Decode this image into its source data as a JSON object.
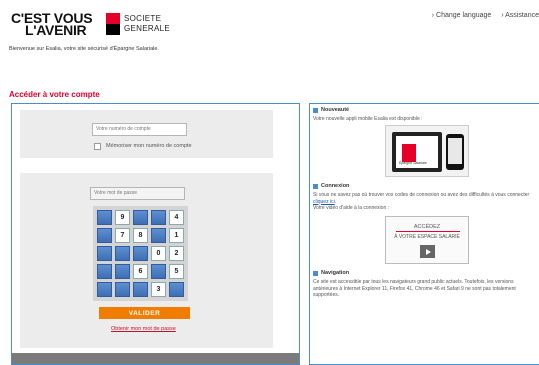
{
  "header": {
    "brand_line1": "C'EST VOUS",
    "brand_line2": "L'AVENIR",
    "bank_line1": "SOCIETE",
    "bank_line2": "GENERALE",
    "change_language": "› Change language",
    "assistance": "› Assistance",
    "welcome": "Bienvenue sur Esalia, votre site sécurisé d'Épargne Salariale."
  },
  "login": {
    "title": "Accéder à votre compte",
    "account_placeholder": "Votre numéro de compte",
    "remember_label": "Mémoriser mon numéro de compte",
    "password_placeholder": "Votre mot de passe",
    "keypad": [
      "",
      "9",
      "",
      "",
      "4",
      "",
      "7",
      "8",
      "",
      "1",
      "",
      "",
      "",
      "0",
      "2",
      "",
      "",
      "6",
      "",
      "5",
      "",
      "",
      "",
      "3",
      ""
    ],
    "validate_button": "VALIDER",
    "forgot_link": "Obtenir mon mot de passe"
  },
  "news": {
    "title": "Nouveauté",
    "text": "Votre nouvelle appli mobile Esalia est disponible :",
    "tablet_caption": "Épargne Salariale"
  },
  "connexion": {
    "title": "Connexion",
    "text_before_link": "Si vous ne savez pas où trouver vos codes de connexion ou avez des difficultés à vous connecter ",
    "link": "cliquez ici",
    "text_after_link": ".",
    "video_intro": "Votre vidéo d'aide à la connexion :",
    "video_title": "ACCÉDEZ",
    "video_subtitle": "À VOTRE ESPACE SALARIÉ"
  },
  "navigation": {
    "title": "Navigation",
    "text": "Ce site est accessible par tous les navigateurs grand public actuels. Toutefois, les versions antérieures à Internet Explorer 11, Firefox 41, Chrome 46 et Safari 9 ne sont pas totalement supportées."
  },
  "colors": {
    "accent_red": "#e4002b",
    "panel_border": "#4a8ec9",
    "button_orange": "#f07c00"
  }
}
